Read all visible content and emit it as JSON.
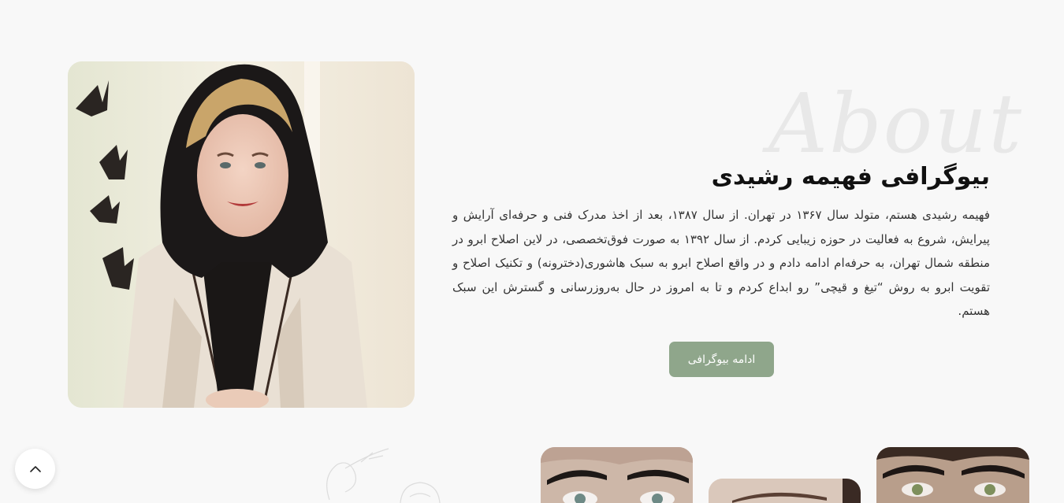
{
  "about": {
    "watermark": "About",
    "title": "بیوگرافی فهیمه رشیدی",
    "text": "فهیمه رشیدی هستم، متولد سال ۱۳۶۷ در تهران. از سال ۱۳۸۷، بعد از اخذ مدرک فنی و حرفه‌ای آرایش و پیرایش، شروع به فعالیت در حوزه زیبایی کردم. از سال ۱۳۹۲ به صورت فوق‌تخصصی، در لاین اصلاح ابرو در منطقه شمال تهران، به حرفه‌ام ادامه دادم و در واقع اصلاح ابرو به سبک هاشوری(دخترونه) و تکنیک اصلاح و تقویت ابرو به روش “تیغ و قیچی” رو ابداع کردم و تا به امروز در حال به‌روزرسانی و گسترش این سبک هستم.",
    "button_label": "ادامه بیوگرافی"
  },
  "icons": {
    "scroll_top": "chevron-up-icon",
    "portrait": "portrait-photo",
    "decoration": "floral-sketch"
  },
  "colors": {
    "accent": "#8fa68b",
    "background": "#f8f8f8",
    "title": "#111111",
    "text": "#333333"
  }
}
